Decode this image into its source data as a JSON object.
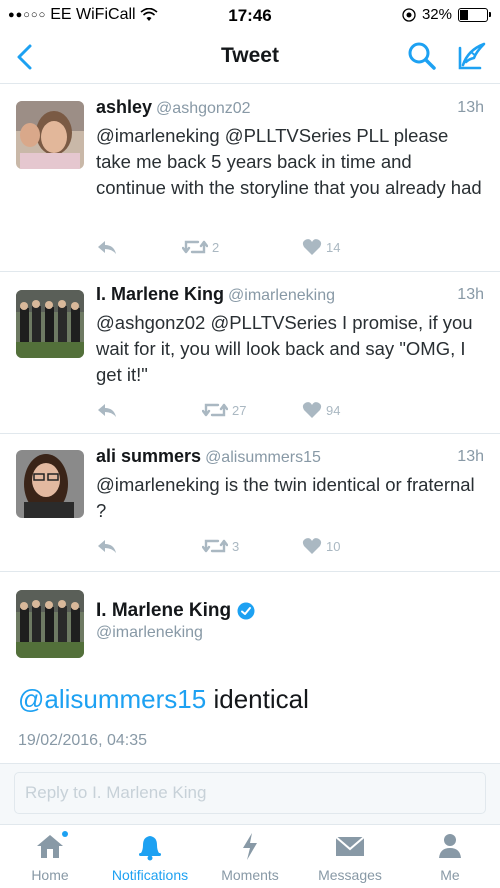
{
  "status": {
    "carrier": "EE WiFiCall",
    "time": "17:46",
    "battery": "32%",
    "battery_level": 0.32
  },
  "nav": {
    "title": "Tweet"
  },
  "tweets": [
    {
      "name": "ashley",
      "handle": "@ashgonz02",
      "time": "13h",
      "text": "@imarleneking @PLLTVSeries PLL please take me back 5 years back in time and continue with the storyline that you already had",
      "retweets": "2",
      "likes": "14"
    },
    {
      "name": "I. Marlene King",
      "handle": "@imarleneking",
      "time": "13h",
      "text": "@ashgonz02 @PLLTVSeries I promise, if you wait for it, you will look back and say \"OMG, I get it!\"",
      "retweets": "27",
      "likes": "94"
    },
    {
      "name": "ali summers",
      "handle": "@alisummers15",
      "time": "13h",
      "text": "@imarleneking is the twin identical or fraternal ?",
      "retweets": "3",
      "likes": "10"
    }
  ],
  "main_tweet": {
    "name": "I. Marlene King",
    "handle": "@imarleneking",
    "mention": "@alisummers15",
    "text": " identical",
    "date": "19/02/2016, 04:35"
  },
  "reply": {
    "placeholder": "Reply to I. Marlene King"
  },
  "tabs": [
    {
      "label": "Home",
      "icon": "home-icon"
    },
    {
      "label": "Notifications",
      "icon": "bell-icon"
    },
    {
      "label": "Moments",
      "icon": "lightning-icon"
    },
    {
      "label": "Messages",
      "icon": "envelope-icon"
    },
    {
      "label": "Me",
      "icon": "person-icon"
    }
  ],
  "colors": {
    "accent": "#1da1f2",
    "muted": "#8899a6",
    "action_gray": "#aab8c2"
  }
}
